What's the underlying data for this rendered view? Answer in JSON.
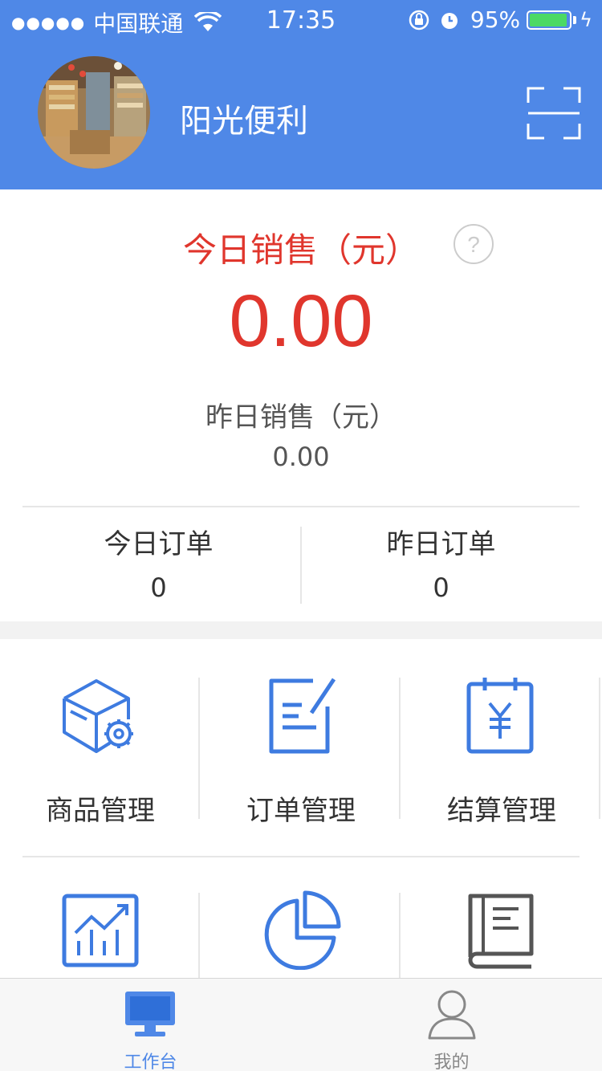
{
  "status_bar": {
    "signal": "●●●●●",
    "carrier": "中国联通",
    "time": "17:35",
    "battery_percent": "95%",
    "battery_level": 0.95
  },
  "header": {
    "store_name": "阳光便利",
    "accent_color": "#4f88e7"
  },
  "sales": {
    "today_label": "今日销售（元）",
    "today_value": "0.00",
    "yesterday_label": "昨日销售（元）",
    "yesterday_value": "0.00",
    "highlight_color": "#e0362d"
  },
  "orders": {
    "today_label": "今日订单",
    "today_value": "0",
    "yesterday_label": "昨日订单",
    "yesterday_value": "0"
  },
  "menu": [
    {
      "label": "商品管理",
      "icon": "product-box-gear-icon"
    },
    {
      "label": "订单管理",
      "icon": "order-edit-icon"
    },
    {
      "label": "结算管理",
      "icon": "settlement-calendar-yen-icon"
    },
    {
      "label": "",
      "icon": "statistics-chart-icon"
    },
    {
      "label": "",
      "icon": "pie-chart-icon"
    },
    {
      "label": "",
      "icon": "book-icon"
    }
  ],
  "tabbar": {
    "tabs": [
      {
        "label": "工作台",
        "icon": "monitor-icon",
        "active": true
      },
      {
        "label": "我的",
        "icon": "user-icon",
        "active": false
      }
    ],
    "active_color": "#4f88e7",
    "inactive_color": "#888888"
  }
}
